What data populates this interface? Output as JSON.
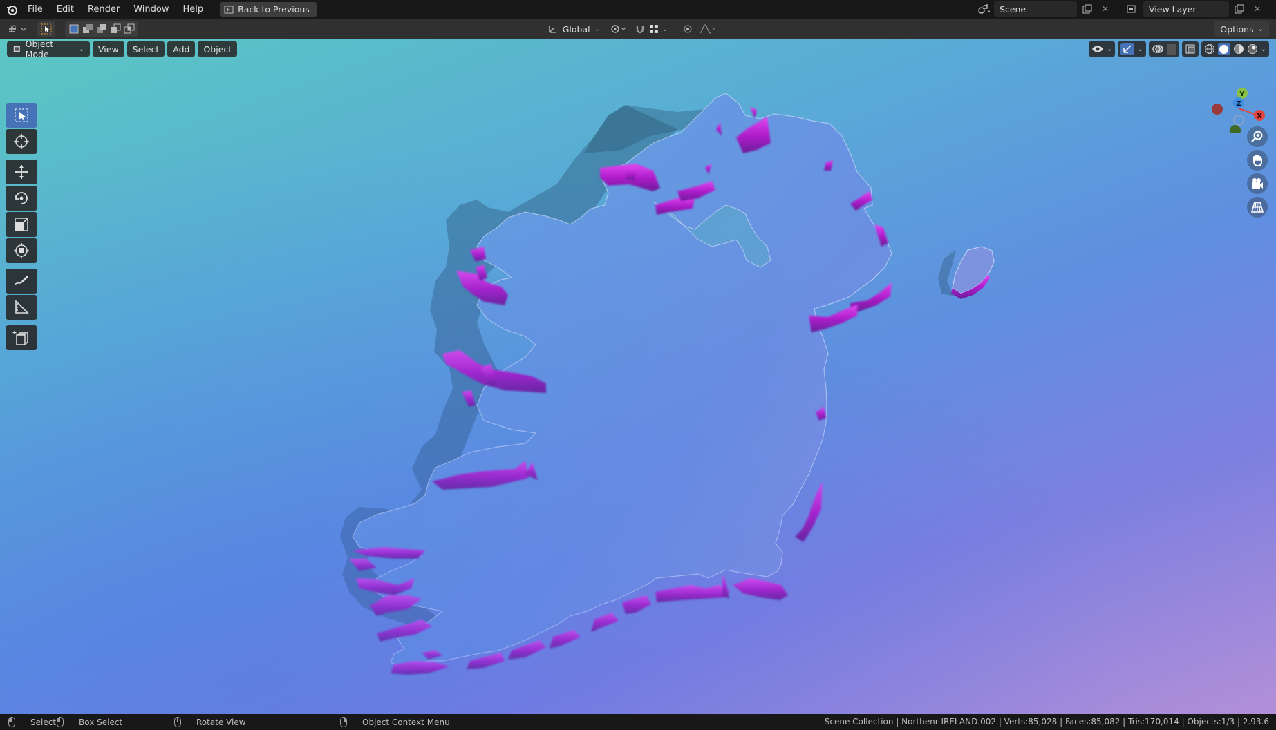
{
  "menubar": {
    "items": [
      "File",
      "Edit",
      "Render",
      "Window",
      "Help"
    ],
    "back_label": "Back to Previous",
    "scene_name": "Scene",
    "view_layer": "View Layer"
  },
  "toolheader": {
    "orientation": "Global",
    "options_label": "Options"
  },
  "viewport": {
    "mode_label": "Object Mode",
    "menu": [
      "View",
      "Select",
      "Add",
      "Object"
    ],
    "gizmo_axes": [
      "Y",
      "Z",
      "X"
    ]
  },
  "statusbar": {
    "select": "Select",
    "box_select": "Box Select",
    "rotate_view": "Rotate View",
    "context_menu": "Object Context Menu",
    "stats": "Scene Collection | Northenr IRELAND.002 | Verts:85,028 | Faces:85,082 | Tris:170,014 | Objects:1/3 | 2.93.6"
  },
  "colors": {
    "accent": "#4672b7",
    "axis_x": "#e0453e",
    "axis_y": "#8ac044",
    "axis_z": "#3f8fe0",
    "extrude_magenta": "#c22bd8"
  }
}
